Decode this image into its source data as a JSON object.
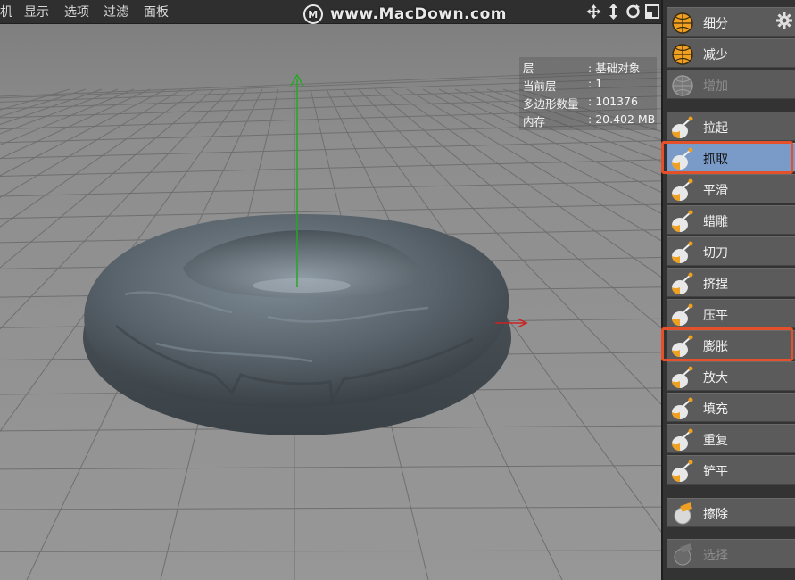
{
  "menu": {
    "items": [
      "机",
      "显示",
      "选项",
      "过滤",
      "面板"
    ]
  },
  "watermark": {
    "logo_letter": "M",
    "text": "www.MacDown.com"
  },
  "info": {
    "rows": [
      {
        "key": "层",
        "value": "基础对象"
      },
      {
        "key": "当前层",
        "value": "1"
      },
      {
        "key": "多边形数量",
        "value": "101376"
      },
      {
        "key": "内存",
        "value": "20.402 MB"
      }
    ]
  },
  "tools": [
    {
      "label": "细分",
      "icon": "subdivide-sphere-icon"
    },
    {
      "label": "减少",
      "icon": "decrease-sphere-icon"
    },
    {
      "label": "增加",
      "icon": "increase-sphere-icon",
      "disabled": true
    },
    {
      "label": "拉起",
      "icon": "pull-brush-icon"
    },
    {
      "label": "抓取",
      "icon": "grab-brush-icon",
      "selected": true
    },
    {
      "label": "平滑",
      "icon": "smooth-brush-icon"
    },
    {
      "label": "蜡雕",
      "icon": "wax-brush-icon"
    },
    {
      "label": "切刀",
      "icon": "knife-brush-icon"
    },
    {
      "label": "挤捏",
      "icon": "pinch-brush-icon"
    },
    {
      "label": "压平",
      "icon": "flatten-brush-icon"
    },
    {
      "label": "膨胀",
      "icon": "inflate-brush-icon"
    },
    {
      "label": "放大",
      "icon": "amplify-brush-icon"
    },
    {
      "label": "填充",
      "icon": "fill-brush-icon"
    },
    {
      "label": "重复",
      "icon": "repeat-brush-icon"
    },
    {
      "label": "铲平",
      "icon": "scrape-brush-icon"
    },
    {
      "label": "擦除",
      "icon": "erase-brush-icon"
    },
    {
      "label": "选择",
      "icon": "select-brush-icon",
      "disabled": true
    }
  ],
  "colors": {
    "accent_orange": "#f0a020",
    "selected_blue": "#7a9ac8",
    "highlight_red": "#e4502a",
    "axis_green": "#22aa22",
    "axis_red": "#cc2222"
  }
}
